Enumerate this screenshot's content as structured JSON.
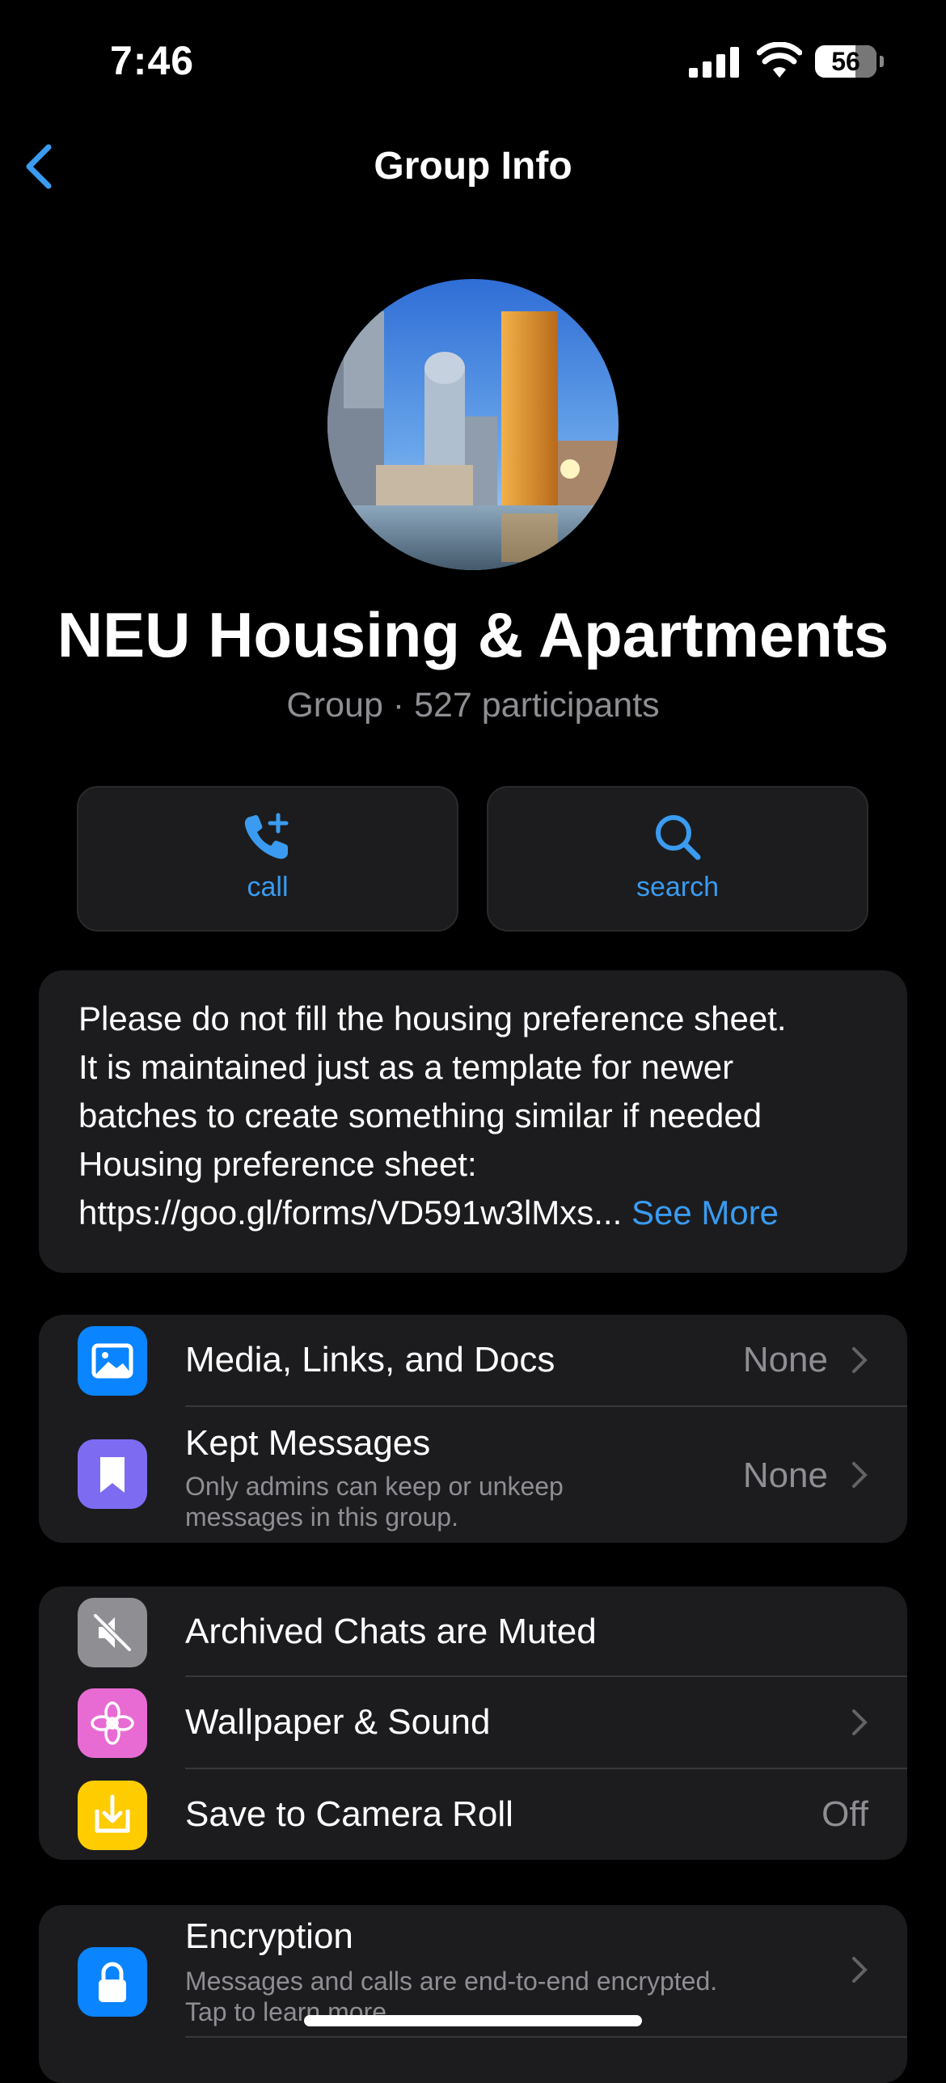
{
  "status_bar": {
    "time": "7:46",
    "battery": "56"
  },
  "nav": {
    "title": "Group Info"
  },
  "group": {
    "name": "NEU Housing & Apartments",
    "subtitle": "Group · 527 participants"
  },
  "actions": {
    "call": "call",
    "search": "search"
  },
  "description": {
    "line1": "Please do not fill the housing preference sheet.",
    "line2": "It is maintained just as a template for newer",
    "line3": "batches to create something similar if needed",
    "line4": "Housing preference sheet:",
    "line5": "https://goo.gl/forms/VD591w3lMxs...",
    "see_more": "See More"
  },
  "section1": {
    "media": {
      "title": "Media, Links, and Docs",
      "value": "None"
    },
    "kept": {
      "title": "Kept Messages",
      "subtitle_1": "Only admins can keep or unkeep",
      "subtitle_2": "messages in this group.",
      "value": "None"
    }
  },
  "section2": {
    "archived": {
      "title": "Archived Chats are Muted"
    },
    "wallpaper": {
      "title": "Wallpaper & Sound"
    },
    "camera_roll": {
      "title": "Save to Camera Roll",
      "value": "Off"
    }
  },
  "section3": {
    "encryption": {
      "title": "Encryption",
      "subtitle_1": "Messages and calls are end-to-end encrypted.",
      "subtitle_2": "Tap to learn more."
    }
  },
  "colors": {
    "accent": "#3a9bf0",
    "media_icon": "#0a84ff",
    "kept_icon": "#7d6cf2",
    "archived_icon": "#8e8e93",
    "wallpaper_icon": "#e86bd3",
    "camera_icon": "#ffcc00",
    "encryption_icon": "#0a84ff"
  }
}
